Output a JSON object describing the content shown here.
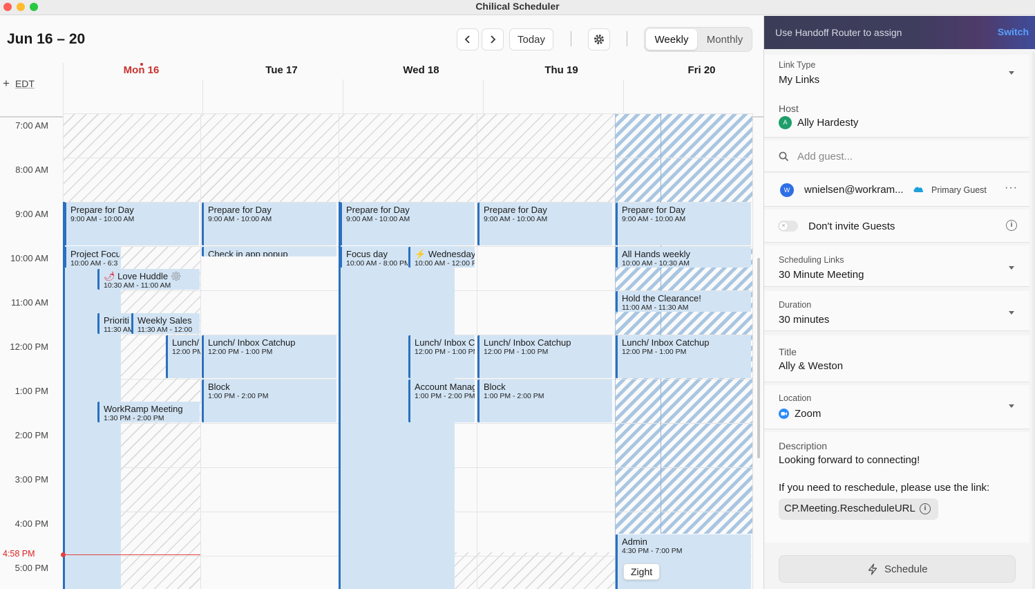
{
  "window": {
    "title": "Chilical Scheduler"
  },
  "header": {
    "date_range": "Jun 16 – 20",
    "today_label": "Today",
    "view_weekly": "Weekly",
    "view_monthly": "Monthly",
    "timezone": "EDT"
  },
  "days": [
    {
      "label": "Mon 16",
      "today": true
    },
    {
      "label": "Tue 17"
    },
    {
      "label": "Wed 18"
    },
    {
      "label": "Thu 19"
    },
    {
      "label": "Fri 20"
    }
  ],
  "time_labels": [
    "7:00 AM",
    "8:00 AM",
    "9:00 AM",
    "10:00 AM",
    "11:00 AM",
    "12:00 PM",
    "1:00 PM",
    "2:00 PM",
    "3:00 PM",
    "4:00 PM",
    "5:00 PM"
  ],
  "now_label": "4:58 PM",
  "events": [
    {
      "title": "Prepare for Day",
      "time": "9:00 AM - 10:00 AM"
    },
    {
      "title": "Project Focu",
      "time": "10:00 AM - 6:3"
    },
    {
      "title": "Love Huddle",
      "time": "10:30 AM - 11:00 AM"
    },
    {
      "title": "Prioriti",
      "time": "11:30 AM"
    },
    {
      "title": "Weekly Sales",
      "time": "11:30 AM - 12:00"
    },
    {
      "title": "Lunch/",
      "time": "12:00 PM"
    },
    {
      "title": "WorkRamp Meeting",
      "time": "1:30 PM - 2:00 PM"
    },
    {
      "title": "Prepare for Day",
      "time": "9:00 AM - 10:00 AM"
    },
    {
      "title": "Check in app popup",
      "time": ""
    },
    {
      "title": "Lunch/ Inbox Catchup",
      "time": "12:00 PM - 1:00 PM"
    },
    {
      "title": "Block",
      "time": "1:00 PM - 2:00 PM"
    },
    {
      "title": "Prepare for Day",
      "time": "9:00 AM - 10:00 AM"
    },
    {
      "title": "Focus day",
      "time": "10:00 AM - 8:00 PM"
    },
    {
      "title": "Wednesday",
      "time": "10:00 AM - 12:00 P"
    },
    {
      "title": "Lunch/ Inbox C",
      "time": "12:00 PM - 1:00 PM"
    },
    {
      "title": "Account Manag",
      "time": "1:00 PM - 2:00 PM"
    },
    {
      "title": "Prepare for Day",
      "time": "9:00 AM - 10:00 AM"
    },
    {
      "title": "Lunch/ Inbox Catchup",
      "time": "12:00 PM - 1:00 PM"
    },
    {
      "title": "Block",
      "time": "1:00 PM - 2:00 PM"
    },
    {
      "title": "Prepare for Day",
      "time": "9:00 AM - 10:00 AM"
    },
    {
      "title": "All Hands weekly",
      "time": "10:00 AM - 10:30 AM"
    },
    {
      "title": "Hold the Clearance!",
      "time": "11:00 AM - 11:30 AM"
    },
    {
      "title": "Lunch/ Inbox Catchup",
      "time": "12:00 PM - 1:00 PM"
    },
    {
      "title": "Admin",
      "time": "4:30 PM - 7:00 PM"
    }
  ],
  "tooltip": "Zight",
  "panel": {
    "banner_text": "Use Handoff Router to assign",
    "banner_action": "Switch",
    "link_type_label": "Link Type",
    "link_type_value": "My Links",
    "host_label": "Host",
    "host_value": "Ally Hardesty",
    "host_initial": "A",
    "guest_placeholder": "Add guest...",
    "guest_email": "wnielsen@workram...",
    "guest_initial": "W",
    "guest_role": "Primary Guest",
    "dont_invite_label": "Don't invite Guests",
    "sched_links_label": "Scheduling Links",
    "sched_links_value": "30 Minute Meeting",
    "duration_label": "Duration",
    "duration_value": "30 minutes",
    "title_label": "Title",
    "title_value": "Ally & Weston",
    "location_label": "Location",
    "location_value": "Zoom",
    "description_label": "Description",
    "description_line1": "Looking forward to connecting!",
    "description_line2": "If you need to reschedule, please use the link:",
    "reschedule_token": "CP.Meeting.RescheduleURL",
    "schedule_button": "Schedule"
  }
}
